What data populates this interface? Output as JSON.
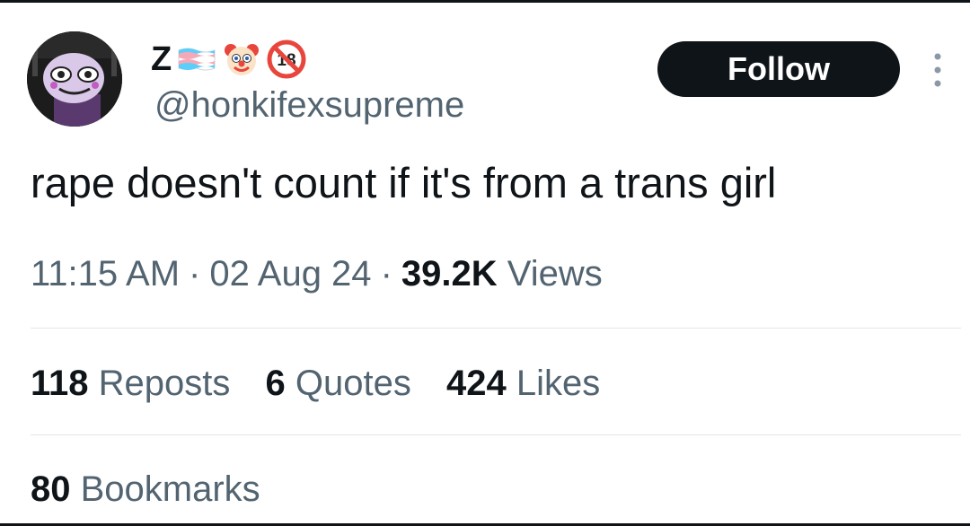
{
  "user": {
    "display_name": "Z",
    "handle": "@honkifexsupreme",
    "badges": [
      "transgender-flag-icon",
      "clown-face-icon",
      "no-under-18-icon"
    ]
  },
  "actions": {
    "follow_label": "Follow",
    "more_icon": "more-vertical-icon"
  },
  "tweet": {
    "text": "rape doesn't count if it's from a trans girl",
    "time": "11:15 AM",
    "date": "02 Aug 24",
    "views_count": "39.2K",
    "views_label": "Views",
    "separator": "·"
  },
  "stats": {
    "reposts_count": "118",
    "reposts_label": "Reposts",
    "quotes_count": "6",
    "quotes_label": "Quotes",
    "likes_count": "424",
    "likes_label": "Likes",
    "bookmarks_count": "80",
    "bookmarks_label": "Bookmarks"
  },
  "colors": {
    "text_primary": "#0f1419",
    "text_secondary": "#536471",
    "divider": "#e1e5e8",
    "follow_bg": "#0f1419",
    "follow_text": "#ffffff"
  }
}
